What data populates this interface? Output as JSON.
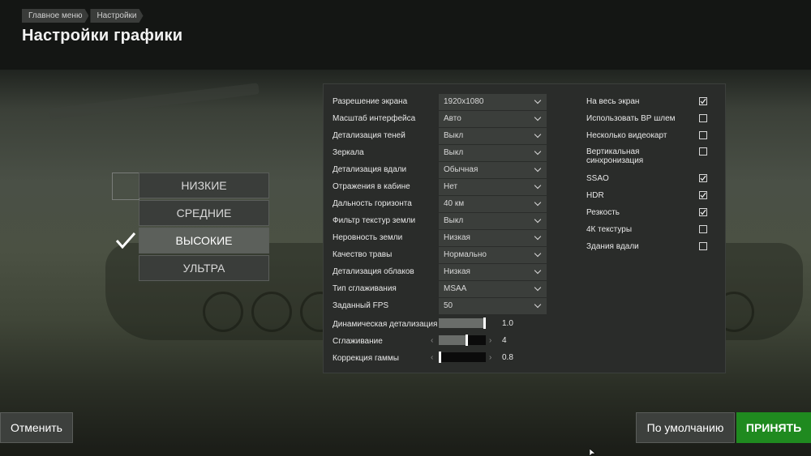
{
  "breadcrumb": [
    "Главное меню",
    "Настройки"
  ],
  "page_title": "Настройки графики",
  "presets": [
    {
      "label": "НИЗКИЕ",
      "active": false
    },
    {
      "label": "СРЕДНИЕ",
      "active": false
    },
    {
      "label": "ВЫСОКИЕ",
      "active": true
    },
    {
      "label": "УЛЬТРА",
      "active": false
    }
  ],
  "settings": [
    {
      "label": "Разрешение экрана",
      "value": "1920x1080"
    },
    {
      "label": "Масштаб интерфейса",
      "value": "Авто"
    },
    {
      "label": "Детализация теней",
      "value": "Выкл"
    },
    {
      "label": "Зеркала",
      "value": "Выкл"
    },
    {
      "label": "Детализация вдали",
      "value": "Обычная"
    },
    {
      "label": "Отражения в кабине",
      "value": "Нет"
    },
    {
      "label": "Дальность горизонта",
      "value": "40 км"
    },
    {
      "label": "Фильтр текстур земли",
      "value": "Выкл"
    },
    {
      "label": "Неровность земли",
      "value": "Низкая"
    },
    {
      "label": "Качество травы",
      "value": "Нормально"
    },
    {
      "label": "Детализация облаков",
      "value": "Низкая"
    },
    {
      "label": "Тип сглаживания",
      "value": "MSAA"
    },
    {
      "label": "Заданный FPS",
      "value": "50"
    }
  ],
  "sliders": [
    {
      "label": "Динамическая детализация",
      "value": "1.0",
      "level": 1.0
    },
    {
      "label": "Сглаживание",
      "value": "4",
      "level": 0.6
    },
    {
      "label": "Коррекция гаммы",
      "value": "0.8",
      "level": 0.0
    }
  ],
  "checkboxes": [
    {
      "label": "На весь экран",
      "checked": true
    },
    {
      "label": "Использовать ВР шлем",
      "checked": false
    },
    {
      "label": "Несколько видеокарт",
      "checked": false
    },
    {
      "label": "Вертикальная синхронизация",
      "checked": false
    },
    {
      "label": "SSAO",
      "checked": true
    },
    {
      "label": "HDR",
      "checked": true
    },
    {
      "label": "Резкость",
      "checked": true
    },
    {
      "label": "4К текстуры",
      "checked": false
    },
    {
      "label": "Здания вдали",
      "checked": false
    }
  ],
  "buttons": {
    "cancel": "Отменить",
    "default": "По умолчанию",
    "accept": "ПРИНЯТЬ"
  },
  "colors": {
    "accent_green": "#1f8a1f",
    "panel_bg": "#2a2c2a",
    "preset_active_bg": "#5c605b"
  }
}
